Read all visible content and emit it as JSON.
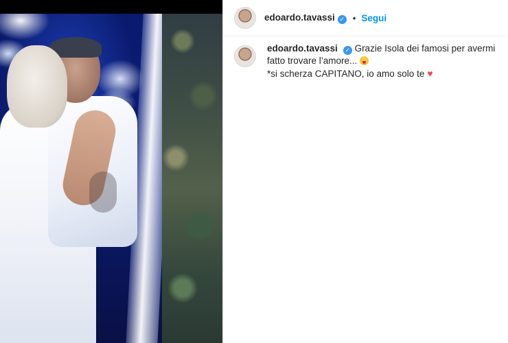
{
  "post": {
    "username": "edoardo.tavassi",
    "verified_badge": "verified-badge-icon",
    "separator": "•",
    "follow_label": "Segui"
  },
  "caption": {
    "username": "edoardo.tavassi",
    "line1": "Grazie Isola dei famosi per avermi fatto trovare l’amore...",
    "emoji1": "zany-face-emoji",
    "line2": "*si scherza CAPITANO, io amo solo te",
    "emoji2": "red-heart-emoji",
    "heart_glyph": "♥"
  },
  "colors": {
    "accent": "#0095f6",
    "verified": "#3897f0",
    "heart": "#ed4956",
    "text": "#262626"
  }
}
